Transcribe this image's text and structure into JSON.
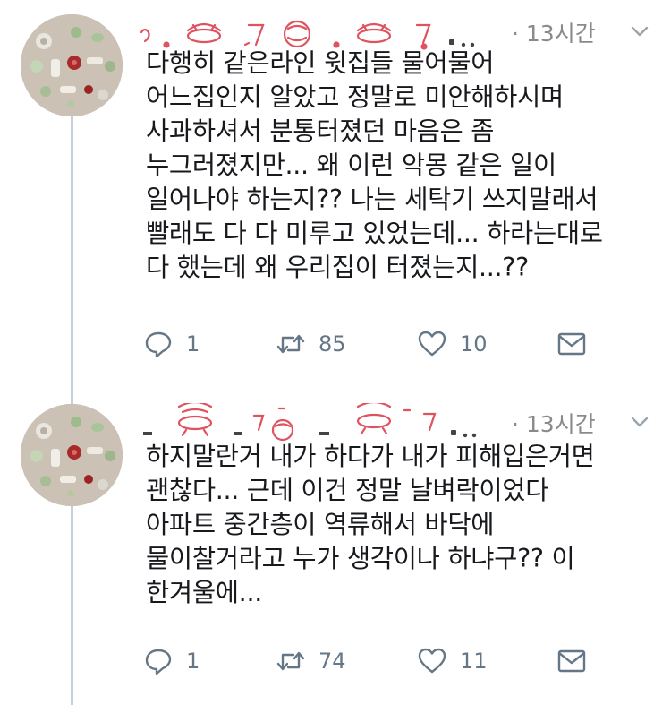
{
  "tweets": [
    {
      "time": "· 13시간",
      "lines": [
        "다행히 같은라인 윗집들 물어물어",
        "어느집인지 알았고 정말로 미안해하시며",
        "사과하셔서 분통터졌던 마음은 좀",
        "누그러졌지만... 왜 이런 악몽 같은 일이",
        "일어나야 하는지?? 나는 세탁기 쓰지말래서",
        "빨래도 다 다 미루고 있었는데... 하라는대로",
        "다 했는데 왜 우리집이 터졌는지...??"
      ],
      "reply_count": "1",
      "retweet_count": "85",
      "like_count": "10"
    },
    {
      "time": "· 13시간",
      "lines": [
        "하지말란거 내가 하다가 내가 피해입은거면",
        "괜찮다... 근데 이건 정말 날벼락이었다",
        "아파트 중간층이 역류해서 바닥에",
        "물이찰거라고 누가 생각이나 하냐구?? 이",
        "한겨울에..."
      ],
      "reply_count": "1",
      "retweet_count": "74",
      "like_count": "11"
    }
  ],
  "icons": {
    "reply": "reply-icon",
    "retweet": "retweet-icon",
    "like": "heart-icon",
    "dm": "envelope-icon",
    "caret": "chevron-down-icon"
  },
  "colors": {
    "text": "#17191c",
    "meta": "#657786",
    "scribble": "#e0525e",
    "thread_line": "#c7d0d8"
  }
}
